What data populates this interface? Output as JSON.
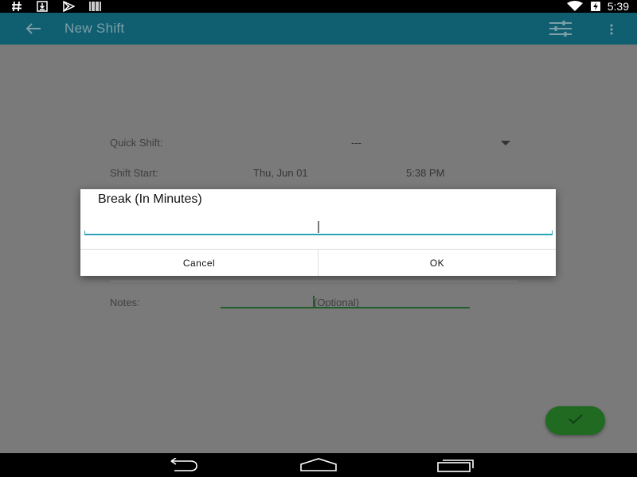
{
  "status_bar": {
    "time": "5:39",
    "left_icons": [
      "hash-icon",
      "download-icon",
      "play-store-icon",
      "barcode-icon"
    ],
    "right_icons": [
      "wifi-icon",
      "battery-charging-icon"
    ]
  },
  "app_bar": {
    "title": "New Shift",
    "icons": [
      "back-arrow-icon",
      "tune-icon",
      "more-vert-icon"
    ]
  },
  "form": {
    "quick_shift_label": "Quick Shift:",
    "quick_shift_value": "---",
    "shift_start_label": "Shift Start:",
    "shift_start_date": "Thu, Jun 01",
    "shift_start_time": "5:38 PM",
    "notes_label": "Notes:",
    "notes_placeholder": "(Optional)"
  },
  "dialog": {
    "title": "Break (In Minutes)",
    "input_value": "",
    "cancel_label": "Cancel",
    "ok_label": "OK"
  },
  "fab": {
    "icon": "check-icon"
  },
  "nav_bar": {
    "icons": [
      "nav-back-icon",
      "nav-home-icon",
      "nav-recents-icon"
    ]
  },
  "colors": {
    "app_bar": "#0f5f71",
    "fab": "#206a22",
    "input_accent": "#2aa3b5",
    "notes_accent": "#1f5e28"
  }
}
